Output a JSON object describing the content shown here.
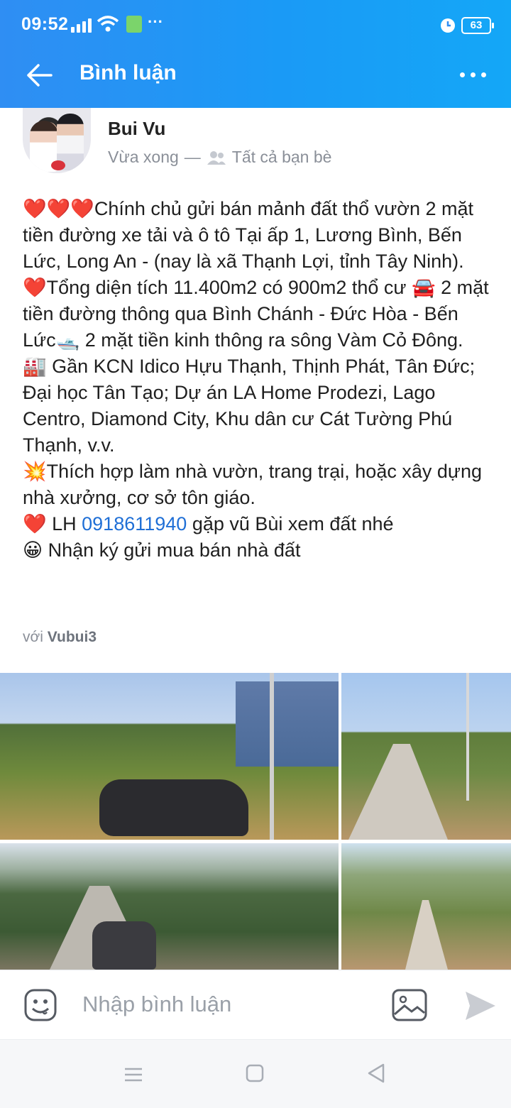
{
  "status_bar": {
    "time": "09:52",
    "dots": "···",
    "battery": "63"
  },
  "header": {
    "title": "Bình luận"
  },
  "post": {
    "author": "Bui Vu",
    "time": "Vừa xong",
    "separator": "—",
    "audience": "Tất cả bạn bè",
    "paragraphs": [
      "❤️❤️❤️Chính chủ gửi bán mảnh đất thổ vườn 2 mặt tiền đường xe tải và ô tô Tại ấp 1, Lương Bình, Bến Lức, Long An - (nay là xã Thạnh Lợi, tỉnh Tây Ninh).",
      "❤️Tổng diện tích 11.400m2 có 900m2 thổ cư 🚘 2 mặt tiền đường thông qua Bình Chánh - Đức Hòa - Bến Lức🛥️ 2 mặt tiền kinh thông ra sông Vàm Cỏ Đông.",
      "🏭 Gần KCN Idico Hựu Thạnh, Thịnh Phát, Tân Đức; Đại học Tân Tạo; Dự án LA Home Prodezi, Lago Centro, Diamond City, Khu dân cư Cát Tường Phú Thạnh, v.v.",
      "💥Thích hợp làm nhà vườn, trang trại, hoặc xây dựng nhà xưởng, cơ sở tôn giáo."
    ],
    "contact_prefix": "❤️ LH ",
    "phone": "0918611940",
    "contact_suffix": " gặp vũ Bùi xem đất nhé",
    "last_line": "😀 Nhận ký gửi mua bán nhà đất",
    "tag_prefix": "với ",
    "tag_name": "Vubui3"
  },
  "composer": {
    "placeholder": "Nhập bình luận"
  },
  "colors": {
    "header_start": "#2f8ef3",
    "header_end": "#14a7f7",
    "link": "#1f6fd6",
    "muted": "#8a8f98"
  },
  "icons": [
    "back-arrow-icon",
    "more-icon",
    "friends-icon",
    "emoji-icon",
    "image-icon",
    "send-icon",
    "menu-icon",
    "home-icon",
    "back-icon"
  ]
}
